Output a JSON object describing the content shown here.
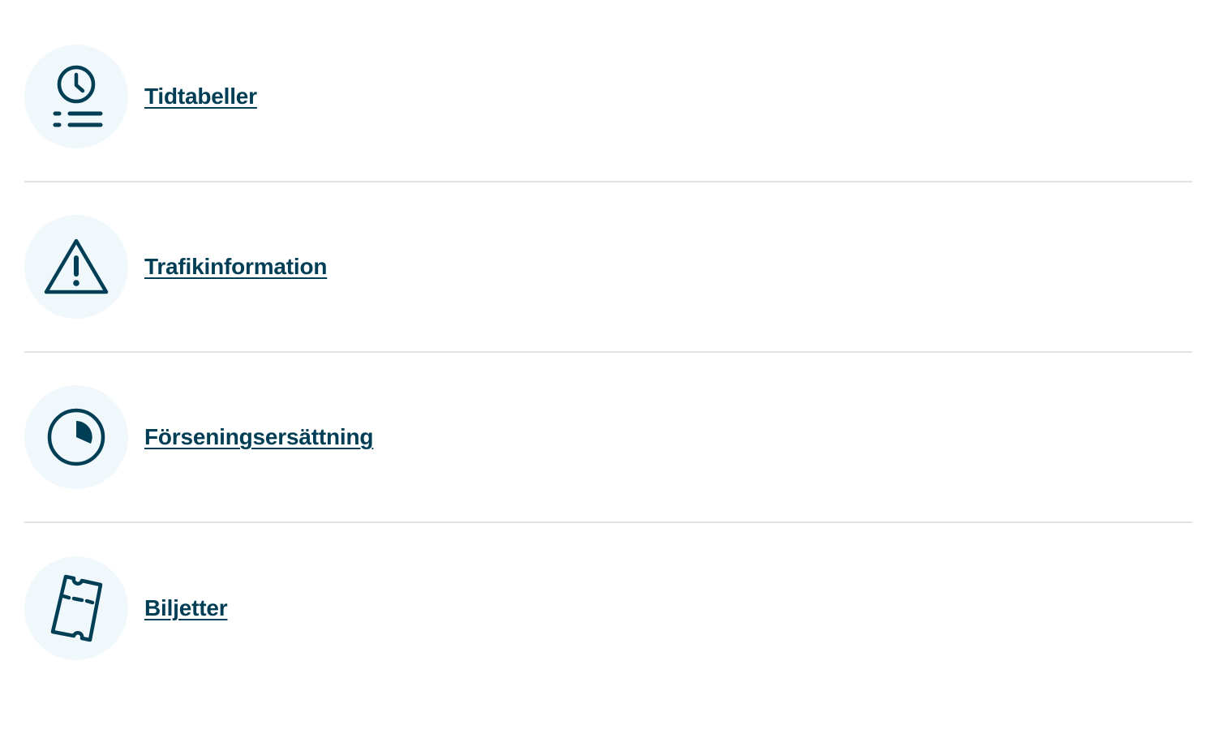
{
  "items": [
    {
      "label": "Tidtabeller",
      "icon": "timetable-icon"
    },
    {
      "label": "Trafikinformation",
      "icon": "warning-icon"
    },
    {
      "label": "Förseningsersättning",
      "icon": "delay-clock-icon"
    },
    {
      "label": "Biljetter",
      "icon": "ticket-icon"
    }
  ],
  "colors": {
    "link": "#003e55",
    "icon_bg": "#f0f8fc",
    "divider": "#e3e3e3"
  }
}
